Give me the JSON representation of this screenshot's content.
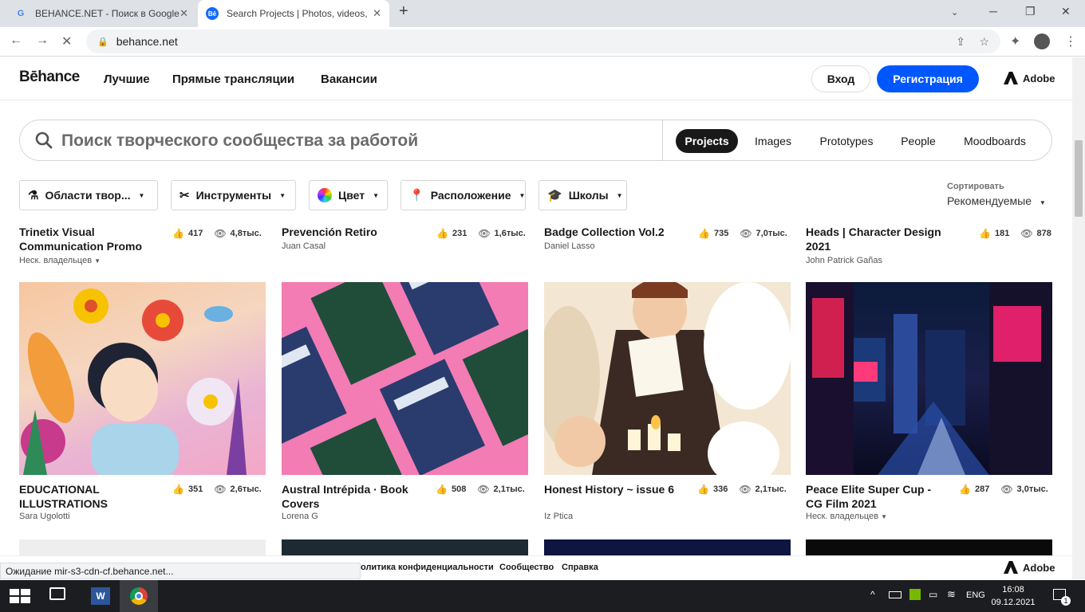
{
  "browser": {
    "tabs": [
      {
        "title": "BEHANCE.NET - Поиск в Google"
      },
      {
        "title": "Search Projects | Photos, videos,"
      }
    ],
    "url": "behance.net",
    "status_text": "Ожидание mir-s3-cdn-cf.behance.net..."
  },
  "header": {
    "logo": "Bēhance",
    "nav": [
      "Лучшие",
      "Прямые трансляции",
      "Вакансии"
    ],
    "login": "Вход",
    "register": "Регистрация",
    "adobe": "Adobe"
  },
  "search": {
    "placeholder": "Поиск творческого сообщества за работой",
    "tabs": [
      "Projects",
      "Images",
      "Prototypes",
      "People",
      "Moodboards"
    ],
    "active_tab": "Projects"
  },
  "filters": [
    "Области твор...",
    "Инструменты",
    "Цвет",
    "Расположение",
    "Школы"
  ],
  "sort": {
    "label": "Сортировать",
    "value": "Рекомендуемые"
  },
  "row1": [
    {
      "title": "Trinetix Visual Communication Promo",
      "owner": "Неск. владельцев",
      "likes": "417",
      "views": "4,8тыс."
    },
    {
      "title": "Prevención Retiro",
      "owner": "Juan Casal",
      "likes": "231",
      "views": "1,6тыс."
    },
    {
      "title": "Badge Collection Vol.2",
      "owner": "Daniel Lasso",
      "likes": "735",
      "views": "7,0тыс."
    },
    {
      "title": "Heads | Character Design 2021",
      "owner": "John Patrick Gañas",
      "likes": "181",
      "views": "878"
    }
  ],
  "row2": [
    {
      "title": "EDUCATIONAL ILLUSTRATIONS",
      "owner": "Sara Ugolotti",
      "likes": "351",
      "views": "2,6тыс."
    },
    {
      "title": "Austral Intrépida · Book Covers",
      "owner": "Lorena G",
      "likes": "508",
      "views": "2,1тыс."
    },
    {
      "title": "Honest History ~ issue 6",
      "owner": "Iz Ptica",
      "likes": "336",
      "views": "2,1тыс."
    },
    {
      "title": "Peace Elite Super Cup - CG Film 2021",
      "owner": "Неск. владельцев",
      "likes": "287",
      "views": "3,0тыс."
    }
  ],
  "footer": {
    "links": [
      "олитика конфиденциальности",
      "Сообщество",
      "Справка"
    ],
    "adobe": "Adobe"
  },
  "taskbar": {
    "lang": "ENG",
    "time": "16:08",
    "date": "09.12.2021",
    "notif_count": "1"
  },
  "colors": {
    "accent": "#0057ff",
    "dark": "#191919"
  }
}
